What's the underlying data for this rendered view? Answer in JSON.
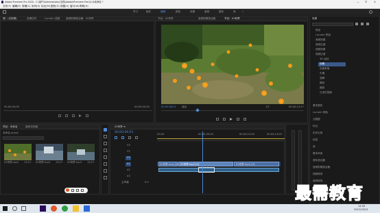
{
  "app": {
    "title": "Adobe Premiere Pro 2020 - C:\\用户\\Administrator\\文档\\Adobe\\Premiere Pro\\14.0\\未命名 *",
    "menus": [
      "文件(F)",
      "编辑(E)",
      "剪辑(C)",
      "序列(S)",
      "标记(M)",
      "图形(G)",
      "视图(V)",
      "窗口(W)",
      "帮助(H)"
    ],
    "window_controls": [
      "—",
      "☐",
      "✕"
    ]
  },
  "workspaces": [
    "学习",
    "组件",
    "编辑",
    "颜色",
    "效果",
    "音频",
    "图形",
    "库",
    "»"
  ],
  "source_panel": {
    "tabs": [
      "源：(无剪辑)",
      "效果控件",
      "Lumetri 范围",
      "音频剪辑混合器：02有界"
    ],
    "timecode_left": "00;00;00;00",
    "timecode_right": "00;00;00;00"
  },
  "program_monitor": {
    "tabs": [
      "节目：02有界",
      "音频剪辑混合器",
      "节目：01有界"
    ],
    "timecode": "00;00;06;01",
    "fit": "适合",
    "scale": "1/2",
    "duration": "00;00;13;27"
  },
  "effects_panel": {
    "title": "效果",
    "items": [
      "预设",
      "Lumetri 预设",
      "音频效果",
      "音频过渡",
      "视频效果",
      "视频过渡",
      "3D 运动",
      "划像",
      "页面剥落",
      "内滑",
      "溶解",
      "擦除",
      "缩放",
      "沉浸式视频"
    ],
    "sections": [
      "基本图形",
      "Lumetri 颜色",
      "元数据",
      "标记",
      "历史记录",
      "信息",
      "库",
      "基本声音",
      "音轨混合器",
      "音频剪辑混合器",
      "视频转场",
      "音频转场",
      "编辑"
    ]
  },
  "project_panel": {
    "tabs": [
      "项目：未命名",
      "媒体浏览器"
    ],
    "project_file": "未命名.prproj",
    "clips": [
      {
        "name": "02有界.mp4",
        "duration": "13;27"
      },
      {
        "name": "02有界.mp4",
        "duration": "13;27"
      },
      {
        "name": "02有界.mp4",
        "duration": "13;27"
      }
    ]
  },
  "timeline": {
    "tab": "02有界 ≡",
    "timecode": "00;00;06;01",
    "ruler": [
      "00;00",
      "00;00;05;00",
      "00;00;10;00",
      "00;00;14;29"
    ],
    "tracks": [
      "V3",
      "V2",
      "V1",
      "A1",
      "A2",
      "A3",
      "主声道"
    ],
    "master_value": "0.0",
    "clips": [
      "02有界.mp4 [V]",
      "02有界.mp4 [V]",
      "02有界.mp4 [V]"
    ]
  },
  "taskbar": {
    "time": "14:45",
    "date": "2021/10/12"
  },
  "watermark": "最需教育"
}
